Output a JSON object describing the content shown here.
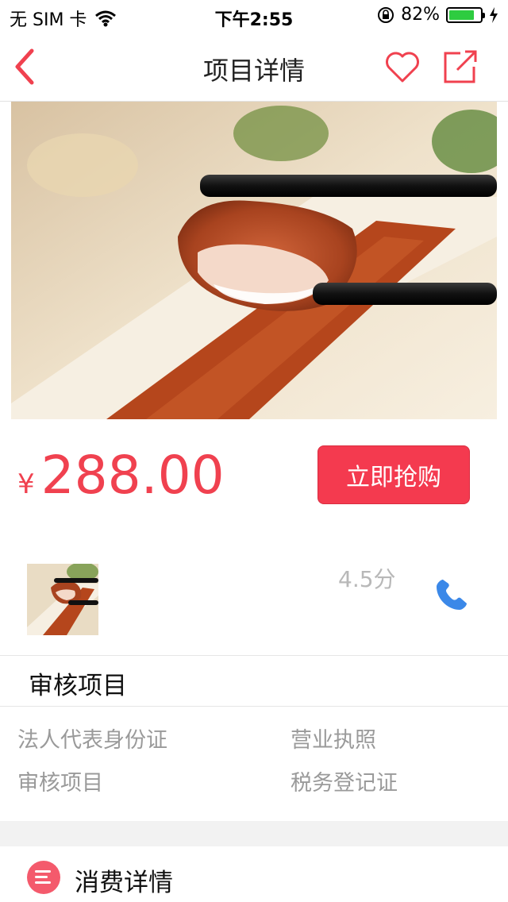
{
  "status_bar": {
    "carrier": "无 SIM 卡",
    "time": "下午2:55",
    "battery": "82%",
    "battery_level": 0.82
  },
  "nav": {
    "title": "项目详情"
  },
  "price": {
    "currency": "¥",
    "amount": "288.00"
  },
  "buy_button": {
    "label": "立即抢购"
  },
  "merchant": {
    "rating": "4.5分"
  },
  "review_section": {
    "title": "审核项目",
    "documents": [
      "法人代表身份证",
      "营业执照",
      "审核项目",
      "税务登记证"
    ]
  },
  "consume": {
    "label": "消费详情"
  },
  "colors": {
    "accent": "#f0414f",
    "button": "#f43a4f",
    "phone_icon": "#3b88e8"
  }
}
